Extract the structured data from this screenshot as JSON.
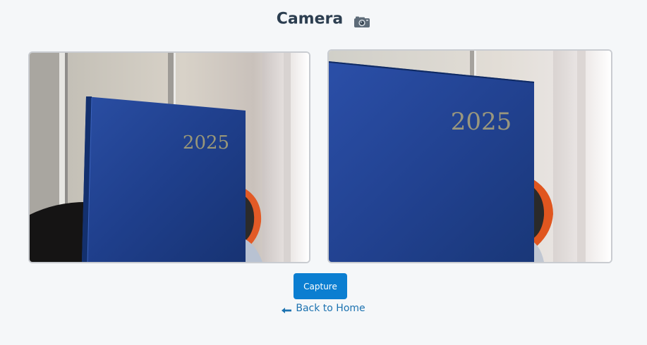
{
  "header": {
    "title": "Camera",
    "icon": "camera-icon"
  },
  "feeds": [
    {
      "name": "camera-feed-left",
      "book_text": "2025"
    },
    {
      "name": "camera-feed-right",
      "book_text": "2025"
    }
  ],
  "actions": {
    "capture_label": "Capture",
    "back_label": "Back to Home",
    "back_icon": "arrow-left-icon"
  },
  "colors": {
    "accent": "#0b7ed1",
    "link": "#1c72b0",
    "title": "#2c3e50",
    "background": "#f5f7f9",
    "book_blue": "#1f3f8c"
  }
}
